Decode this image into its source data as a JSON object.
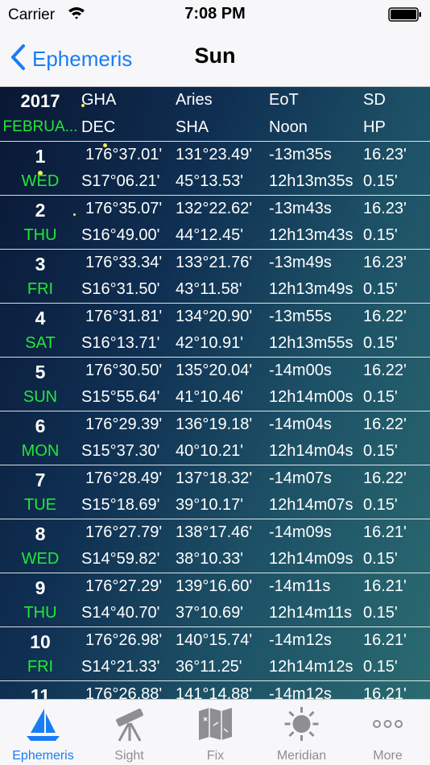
{
  "status_bar": {
    "carrier": "Carrier",
    "time": "7:08 PM"
  },
  "nav": {
    "back_label": "Ephemeris",
    "title": "Sun"
  },
  "header": {
    "year": "2017",
    "month": "FEBRUA...",
    "line1": [
      "GHA",
      "Aries",
      "EoT",
      "SD"
    ],
    "line2": [
      "DEC",
      "SHA",
      "Noon",
      "HP"
    ]
  },
  "rows": [
    {
      "day": "1",
      "weekday": "WED",
      "gha": "176°37.01'",
      "aries": "131°23.49'",
      "eot": "-13m35s",
      "sd": "16.23'",
      "dec": "S17°06.21'",
      "sha": "45°13.53'",
      "noon": "12h13m35s",
      "hp": "0.15'"
    },
    {
      "day": "2",
      "weekday": "THU",
      "gha": "176°35.07'",
      "aries": "132°22.62'",
      "eot": "-13m43s",
      "sd": "16.23'",
      "dec": "S16°49.00'",
      "sha": "44°12.45'",
      "noon": "12h13m43s",
      "hp": "0.15'"
    },
    {
      "day": "3",
      "weekday": "FRI",
      "gha": "176°33.34'",
      "aries": "133°21.76'",
      "eot": "-13m49s",
      "sd": "16.23'",
      "dec": "S16°31.50'",
      "sha": "43°11.58'",
      "noon": "12h13m49s",
      "hp": "0.15'"
    },
    {
      "day": "4",
      "weekday": "SAT",
      "gha": "176°31.81'",
      "aries": "134°20.90'",
      "eot": "-13m55s",
      "sd": "16.22'",
      "dec": "S16°13.71'",
      "sha": "42°10.91'",
      "noon": "12h13m55s",
      "hp": "0.15'"
    },
    {
      "day": "5",
      "weekday": "SUN",
      "gha": "176°30.50'",
      "aries": "135°20.04'",
      "eot": "-14m00s",
      "sd": "16.22'",
      "dec": "S15°55.64'",
      "sha": "41°10.46'",
      "noon": "12h14m00s",
      "hp": "0.15'"
    },
    {
      "day": "6",
      "weekday": "MON",
      "gha": "176°29.39'",
      "aries": "136°19.18'",
      "eot": "-14m04s",
      "sd": "16.22'",
      "dec": "S15°37.30'",
      "sha": "40°10.21'",
      "noon": "12h14m04s",
      "hp": "0.15'"
    },
    {
      "day": "7",
      "weekday": "TUE",
      "gha": "176°28.49'",
      "aries": "137°18.32'",
      "eot": "-14m07s",
      "sd": "16.22'",
      "dec": "S15°18.69'",
      "sha": "39°10.17'",
      "noon": "12h14m07s",
      "hp": "0.15'"
    },
    {
      "day": "8",
      "weekday": "WED",
      "gha": "176°27.79'",
      "aries": "138°17.46'",
      "eot": "-14m09s",
      "sd": "16.21'",
      "dec": "S14°59.82'",
      "sha": "38°10.33'",
      "noon": "12h14m09s",
      "hp": "0.15'"
    },
    {
      "day": "9",
      "weekday": "THU",
      "gha": "176°27.29'",
      "aries": "139°16.60'",
      "eot": "-14m11s",
      "sd": "16.21'",
      "dec": "S14°40.70'",
      "sha": "37°10.69'",
      "noon": "12h14m11s",
      "hp": "0.15'"
    },
    {
      "day": "10",
      "weekday": "FRI",
      "gha": "176°26.98'",
      "aries": "140°15.74'",
      "eot": "-14m12s",
      "sd": "16.21'",
      "dec": "S14°21.33'",
      "sha": "36°11.25'",
      "noon": "12h14m12s",
      "hp": "0.15'"
    },
    {
      "day": "11",
      "weekday": "",
      "gha": "176°26.88'",
      "aries": "141°14.88'",
      "eot": "-14m12s",
      "sd": "16.21'",
      "dec": "",
      "sha": "",
      "noon": "",
      "hp": ""
    }
  ],
  "tabs": [
    {
      "label": "Ephemeris",
      "icon": "sailboat-icon",
      "active": true
    },
    {
      "label": "Sight",
      "icon": "telescope-icon",
      "active": false
    },
    {
      "label": "Fix",
      "icon": "map-icon",
      "active": false
    },
    {
      "label": "Meridian",
      "icon": "sun-icon",
      "active": false
    },
    {
      "label": "More",
      "icon": "more-dots-icon",
      "active": false
    }
  ],
  "colors": {
    "accent": "#1a7cf5",
    "weekday_green": "#22e83a",
    "tab_inactive": "#8e8e93"
  }
}
